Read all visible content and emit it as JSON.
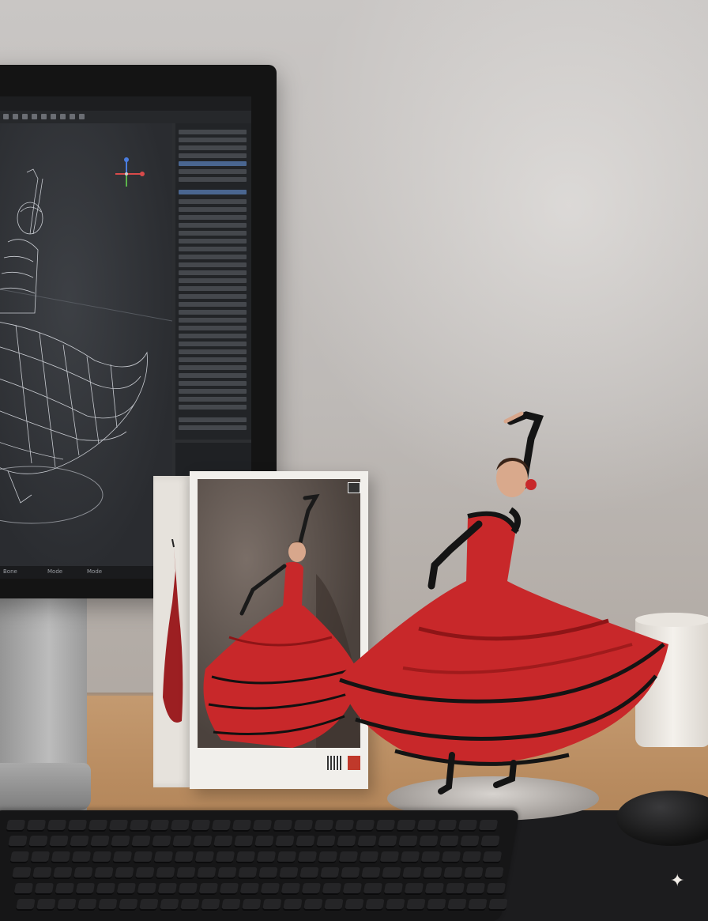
{
  "scene": {
    "description_tags": [
      "desk",
      "monitor-3d-software",
      "figurine-box",
      "flamenco-figurine",
      "mug",
      "keyboard",
      "mouse"
    ]
  },
  "monitor": {
    "status_items": [
      "Bone",
      "Mode",
      "Mode"
    ]
  },
  "colors": {
    "dress_red": "#c8282a",
    "dress_shadow": "#8e1517",
    "lace_black": "#141414",
    "wall": "#c3bfbc",
    "desk_wood": "#b88b5f"
  },
  "icons": {
    "corner": "sparkle-icon"
  }
}
